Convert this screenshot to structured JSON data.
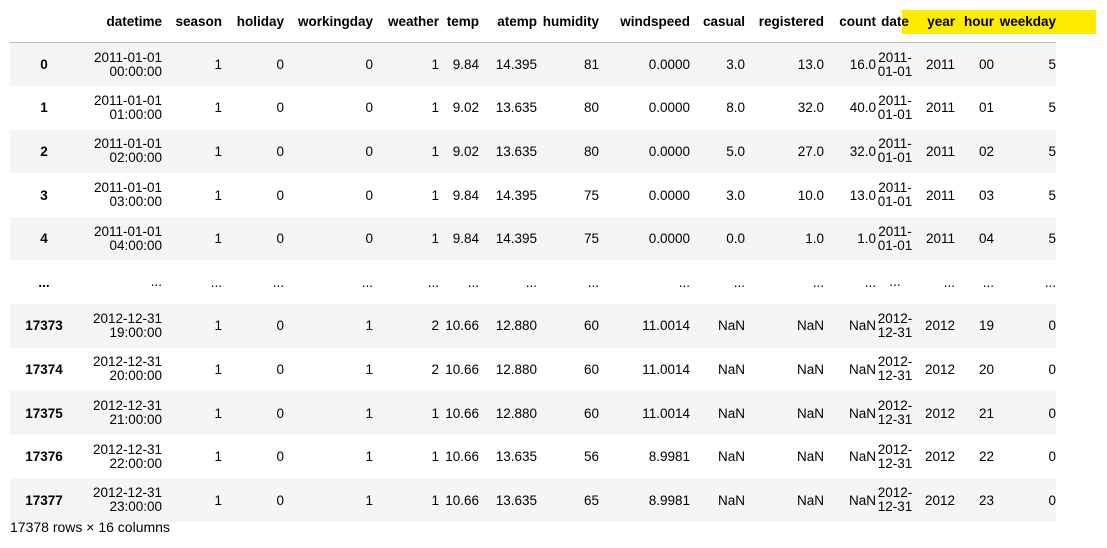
{
  "table": {
    "columns": [
      "datetime",
      "season",
      "holiday",
      "workingday",
      "weather",
      "temp",
      "atemp",
      "humidity",
      "windspeed",
      "casual",
      "registered",
      "count",
      "date",
      "year",
      "hour",
      "weekday"
    ],
    "highlighted_columns": [
      "date",
      "year",
      "hour",
      "weekday"
    ],
    "highlight_color": "#ffeb00",
    "rows": [
      {
        "index": "0",
        "datetime": [
          "2011-01-01",
          "00:00:00"
        ],
        "season": "1",
        "holiday": "0",
        "workingday": "0",
        "weather": "1",
        "temp": "9.84",
        "atemp": "14.395",
        "humidity": "81",
        "windspeed": "0.0000",
        "casual": "3.0",
        "registered": "13.0",
        "count": "16.0",
        "date": [
          "2011-",
          "01-01"
        ],
        "year": "2011",
        "hour": "00",
        "weekday": "5"
      },
      {
        "index": "1",
        "datetime": [
          "2011-01-01",
          "01:00:00"
        ],
        "season": "1",
        "holiday": "0",
        "workingday": "0",
        "weather": "1",
        "temp": "9.02",
        "atemp": "13.635",
        "humidity": "80",
        "windspeed": "0.0000",
        "casual": "8.0",
        "registered": "32.0",
        "count": "40.0",
        "date": [
          "2011-",
          "01-01"
        ],
        "year": "2011",
        "hour": "01",
        "weekday": "5"
      },
      {
        "index": "2",
        "datetime": [
          "2011-01-01",
          "02:00:00"
        ],
        "season": "1",
        "holiday": "0",
        "workingday": "0",
        "weather": "1",
        "temp": "9.02",
        "atemp": "13.635",
        "humidity": "80",
        "windspeed": "0.0000",
        "casual": "5.0",
        "registered": "27.0",
        "count": "32.0",
        "date": [
          "2011-",
          "01-01"
        ],
        "year": "2011",
        "hour": "02",
        "weekday": "5"
      },
      {
        "index": "3",
        "datetime": [
          "2011-01-01",
          "03:00:00"
        ],
        "season": "1",
        "holiday": "0",
        "workingday": "0",
        "weather": "1",
        "temp": "9.84",
        "atemp": "14.395",
        "humidity": "75",
        "windspeed": "0.0000",
        "casual": "3.0",
        "registered": "10.0",
        "count": "13.0",
        "date": [
          "2011-",
          "01-01"
        ],
        "year": "2011",
        "hour": "03",
        "weekday": "5"
      },
      {
        "index": "4",
        "datetime": [
          "2011-01-01",
          "04:00:00"
        ],
        "season": "1",
        "holiday": "0",
        "workingday": "0",
        "weather": "1",
        "temp": "9.84",
        "atemp": "14.395",
        "humidity": "75",
        "windspeed": "0.0000",
        "casual": "0.0",
        "registered": "1.0",
        "count": "1.0",
        "date": [
          "2011-",
          "01-01"
        ],
        "year": "2011",
        "hour": "04",
        "weekday": "5"
      },
      {
        "index": "...",
        "datetime": [
          "..."
        ],
        "season": "...",
        "holiday": "...",
        "workingday": "...",
        "weather": "...",
        "temp": "...",
        "atemp": "...",
        "humidity": "...",
        "windspeed": "...",
        "casual": "...",
        "registered": "...",
        "count": "...",
        "date": [
          "..."
        ],
        "year": "...",
        "hour": "...",
        "weekday": "..."
      },
      {
        "index": "17373",
        "datetime": [
          "2012-12-31",
          "19:00:00"
        ],
        "season": "1",
        "holiday": "0",
        "workingday": "1",
        "weather": "2",
        "temp": "10.66",
        "atemp": "12.880",
        "humidity": "60",
        "windspeed": "11.0014",
        "casual": "NaN",
        "registered": "NaN",
        "count": "NaN",
        "date": [
          "2012-",
          "12-31"
        ],
        "year": "2012",
        "hour": "19",
        "weekday": "0"
      },
      {
        "index": "17374",
        "datetime": [
          "2012-12-31",
          "20:00:00"
        ],
        "season": "1",
        "holiday": "0",
        "workingday": "1",
        "weather": "2",
        "temp": "10.66",
        "atemp": "12.880",
        "humidity": "60",
        "windspeed": "11.0014",
        "casual": "NaN",
        "registered": "NaN",
        "count": "NaN",
        "date": [
          "2012-",
          "12-31"
        ],
        "year": "2012",
        "hour": "20",
        "weekday": "0"
      },
      {
        "index": "17375",
        "datetime": [
          "2012-12-31",
          "21:00:00"
        ],
        "season": "1",
        "holiday": "0",
        "workingday": "1",
        "weather": "1",
        "temp": "10.66",
        "atemp": "12.880",
        "humidity": "60",
        "windspeed": "11.0014",
        "casual": "NaN",
        "registered": "NaN",
        "count": "NaN",
        "date": [
          "2012-",
          "12-31"
        ],
        "year": "2012",
        "hour": "21",
        "weekday": "0"
      },
      {
        "index": "17376",
        "datetime": [
          "2012-12-31",
          "22:00:00"
        ],
        "season": "1",
        "holiday": "0",
        "workingday": "1",
        "weather": "1",
        "temp": "10.66",
        "atemp": "13.635",
        "humidity": "56",
        "windspeed": "8.9981",
        "casual": "NaN",
        "registered": "NaN",
        "count": "NaN",
        "date": [
          "2012-",
          "12-31"
        ],
        "year": "2012",
        "hour": "22",
        "weekday": "0"
      },
      {
        "index": "17377",
        "datetime": [
          "2012-12-31",
          "23:00:00"
        ],
        "season": "1",
        "holiday": "0",
        "workingday": "1",
        "weather": "1",
        "temp": "10.66",
        "atemp": "13.635",
        "humidity": "65",
        "windspeed": "8.9981",
        "casual": "NaN",
        "registered": "NaN",
        "count": "NaN",
        "date": [
          "2012-",
          "12-31"
        ],
        "year": "2012",
        "hour": "23",
        "weekday": "0"
      }
    ]
  },
  "footer": {
    "shape_text": "17378 rows × 16 columns"
  }
}
